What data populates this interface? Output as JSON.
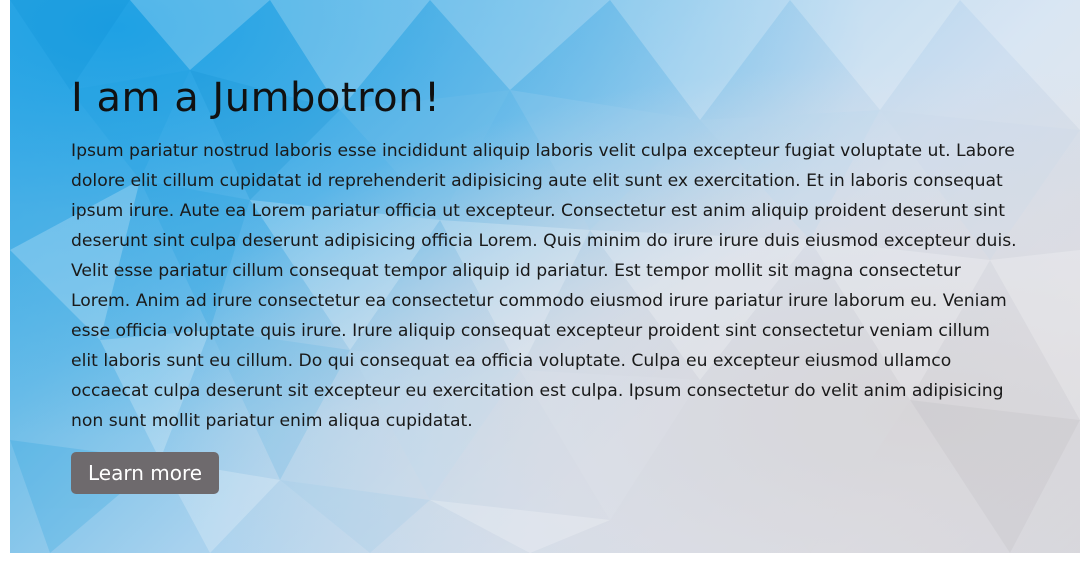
{
  "jumbotron": {
    "title": "I am a Jumbotron!",
    "body": "Ipsum pariatur nostrud laboris esse incididunt aliquip laboris velit culpa excepteur fugiat voluptate ut. Labore dolore elit cillum cupidatat id reprehenderit adipisicing aute elit sunt ex exercitation. Et in laboris consequat ipsum irure. Aute ea Lorem pariatur officia ut excepteur. Consectetur est anim aliquip proident deserunt sint deserunt sint culpa deserunt adipisicing officia Lorem. Quis minim do irure irure duis eiusmod excepteur duis. Velit esse pariatur cillum consequat tempor aliquip id pariatur. Est tempor mollit sit magna consectetur Lorem. Anim ad irure consectetur ea consectetur commodo eiusmod irure pariatur irure laborum eu. Veniam esse officia voluptate quis irure. Irure aliquip consequat excepteur proident sint consectetur veniam cillum elit laboris sunt eu cillum. Do qui consequat ea officia voluptate. Culpa eu excepteur eiusmod ullamco occaecat culpa deserunt sit excepteur eu exercitation est culpa. Ipsum consectetur do velit anim adipisicing non sunt mollit pariatur enim aliqua cupidatat.",
    "button_label": "Learn more"
  },
  "colors": {
    "button_bg": "#6e6a6d",
    "button_text": "#ffffff",
    "background_blue": "#3aaee4",
    "background_gray": "#dcdde3"
  }
}
